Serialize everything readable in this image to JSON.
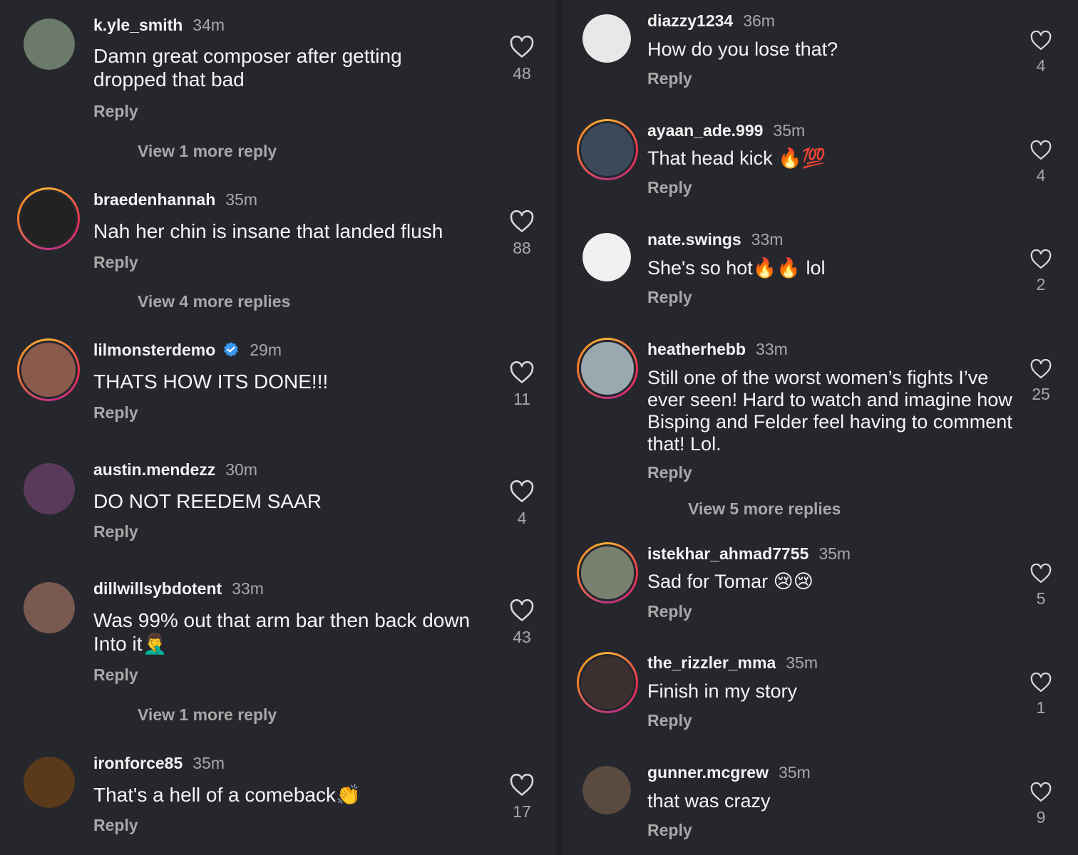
{
  "ui": {
    "reply_label": "Reply",
    "accent_gradient": [
      "#f9b233",
      "#e6304f",
      "#c13584"
    ],
    "verified_color": "#3897f0"
  },
  "left_comments": [
    {
      "username": "k.yle_smith",
      "time": "34m",
      "text": "Damn great composer after getting dropped that bad",
      "likes": "48",
      "view_more": "View 1 more reply",
      "avatar_color": "#6b7a6a"
    },
    {
      "username": "braedenhannah",
      "time": "35m",
      "text": "Nah her chin is insane that landed flush",
      "likes": "88",
      "view_more": "View 4 more replies",
      "avatar_color": "#222222"
    },
    {
      "username": "lilmonsterdemo",
      "time": "29m",
      "text": "THATS HOW ITS DONE!!!",
      "likes": "11",
      "verified": true,
      "avatar_color": "#8a5a4a"
    },
    {
      "username": "austin.mendezz",
      "time": "30m",
      "text": "DO NOT REEDEM SAAR",
      "likes": "4",
      "avatar_color": "#5a3a5a"
    },
    {
      "username": "dillwillsybdotent",
      "time": "33m",
      "text": "Was 99% out that arm bar then back down Into it",
      "text_emoji": "🤦‍♂️",
      "likes": "43",
      "view_more": "View 1 more reply",
      "avatar_color": "#7a5a50"
    },
    {
      "username": "ironforce85",
      "time": "35m",
      "text": "That's a hell of a comeback",
      "text_emoji": "👏",
      "likes": "17",
      "avatar_color": "#5a3a1a"
    }
  ],
  "right_comments": [
    {
      "username": "diazzy1234",
      "time": "36m",
      "text": "How do you lose that?",
      "likes": "4",
      "avatar_color": "#e8e8e8"
    },
    {
      "username": "ayaan_ade.999",
      "time": "35m",
      "text": "That head kick",
      "text_emoji": "🔥💯",
      "likes": "4",
      "avatar_color": "#3a4a5a"
    },
    {
      "username": "nate.swings",
      "time": "33m",
      "text": "She's so hot🔥🔥 lol",
      "likes": "2",
      "avatar_color": "#f0f0f0"
    },
    {
      "username": "heatherhebb",
      "time": "33m",
      "text": "Still one of the worst women’s fights I’ve ever seen! Hard to watch and imagine how Bisping and Felder feel having to comment that! Lol.",
      "likes": "25",
      "view_more": "View 5 more replies",
      "avatar_color": "#9aa8b0"
    },
    {
      "username": "istekhar_ahmad7755",
      "time": "35m",
      "text": "Sad for Tomar",
      "text_emoji": "😢😢",
      "likes": "5",
      "avatar_color": "#7a8070"
    },
    {
      "username": "the_rizzler_mma",
      "time": "35m",
      "text": "Finish in my story",
      "likes": "1",
      "avatar_color": "#3a3030"
    },
    {
      "username": "gunner.mcgrew",
      "time": "35m",
      "text": "that was crazy",
      "likes": "9",
      "avatar_color": "#5a4a40"
    }
  ]
}
